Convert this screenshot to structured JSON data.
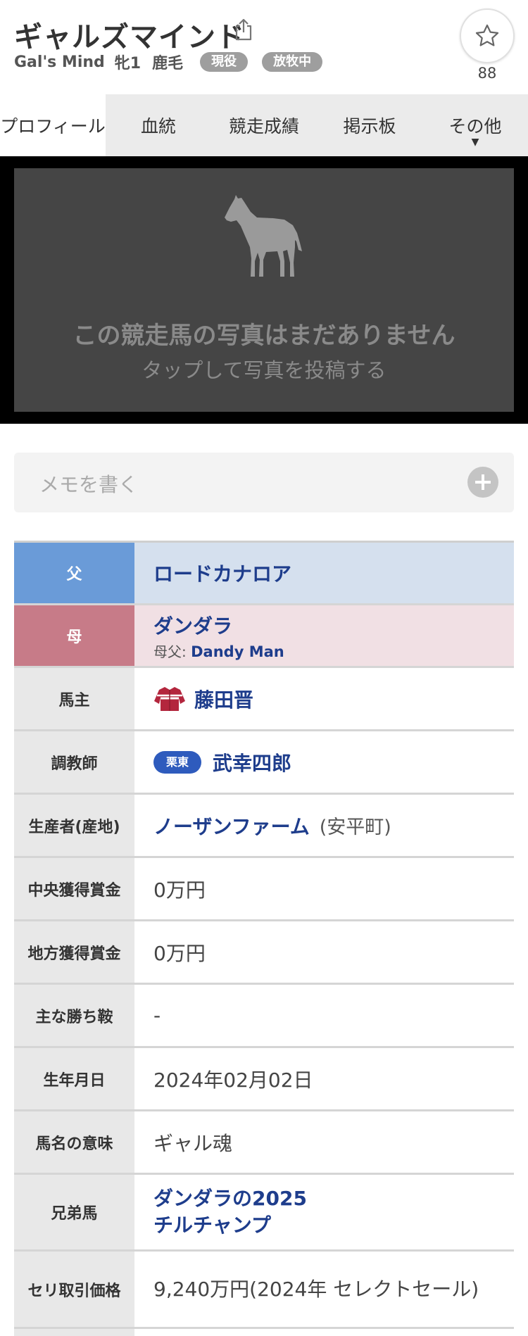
{
  "header": {
    "name_ja": "ギャルズマインド",
    "name_en": "Gal's Mind",
    "sex_age": "牝1",
    "coat": "鹿毛",
    "badges": [
      "現役",
      "放牧中"
    ],
    "favorite_count": "88"
  },
  "tabs": [
    {
      "label": "プロフィール"
    },
    {
      "label": "血統"
    },
    {
      "label": "競走成績"
    },
    {
      "label": "掲示板"
    },
    {
      "label": "その他",
      "arrow": "▼"
    }
  ],
  "photo": {
    "message": "この競走馬の写真はまだありません",
    "sub_message": "タップして写真を投稿する"
  },
  "memo": {
    "placeholder": "メモを書く"
  },
  "profile": {
    "sire_label": "父",
    "sire": "ロードカナロア",
    "dam_label": "母",
    "dam": "ダンダラ",
    "damsire_prefix": "母父:",
    "damsire": "Dandy Man",
    "owner_label": "馬主",
    "owner": "藤田晋",
    "trainer_label": "調教師",
    "trainer_region": "栗東",
    "trainer": "武幸四郎",
    "breeder_label": "生産者(産地)",
    "breeder": "ノーザンファーム",
    "breeder_place": "(安平町)",
    "central_earnings_label": "中央獲得賞金",
    "central_earnings": "0万円",
    "local_earnings_label": "地方獲得賞金",
    "local_earnings": "0万円",
    "main_wins_label": "主な勝ち鞍",
    "main_wins": "-",
    "birthdate_label": "生年月日",
    "birthdate": "2024年02月02日",
    "name_meaning_label": "馬名の意味",
    "name_meaning": "ギャル魂",
    "siblings_label": "兄弟馬",
    "siblings": [
      "ダンダラの2025",
      "チルチャンプ"
    ],
    "auction_label": "セリ取引価格",
    "auction": "9,240万円(2024年 セレクトセール)"
  },
  "colors": {
    "sire_label_bg": "#6a9bd8",
    "sire_value_bg": "#d5e0ee",
    "dam_label_bg": "#c77b88",
    "dam_value_bg": "#f1e0e4",
    "link": "#1e3d8c",
    "region_badge": "#2e5bbd"
  }
}
